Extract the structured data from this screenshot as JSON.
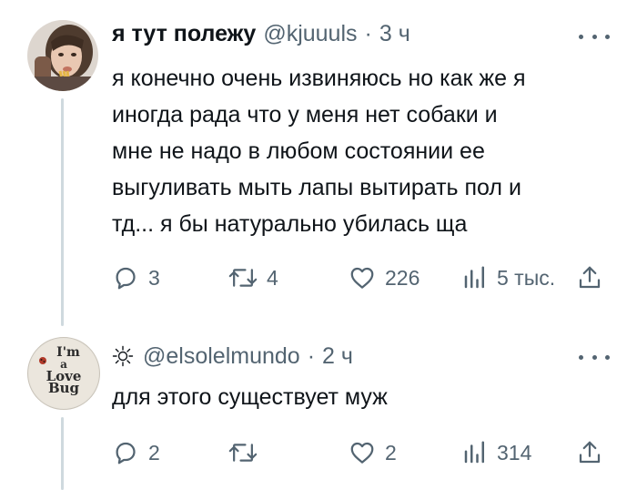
{
  "tweets": [
    {
      "name": "я тут полежу",
      "handle": "@kjuuuls",
      "separator": "·",
      "time": "3 ч",
      "text": "я конечно очень извиняюсь но как же я\nиногда рада что у меня нет собаки и\nмне не надо в любом состоянии ее\nвыгуливать мыть лапы вытирать пол и\nтд... я бы натурально убилась ща",
      "replies": "3",
      "retweets": "4",
      "likes": "226",
      "views": "5 тыс."
    },
    {
      "name": "",
      "name_icon": "sun-icon",
      "handle": "@elsolelmundo",
      "separator": "·",
      "time": "2 ч",
      "text": "для этого существует муж",
      "replies": "2",
      "retweets": "",
      "likes": "2",
      "views": "314",
      "avatar_text": [
        "I'm",
        "a",
        "Love",
        "Bug"
      ]
    }
  ],
  "colors": {
    "text": "#0f1419",
    "secondary": "#536471",
    "thread_line": "#cfd9de"
  }
}
